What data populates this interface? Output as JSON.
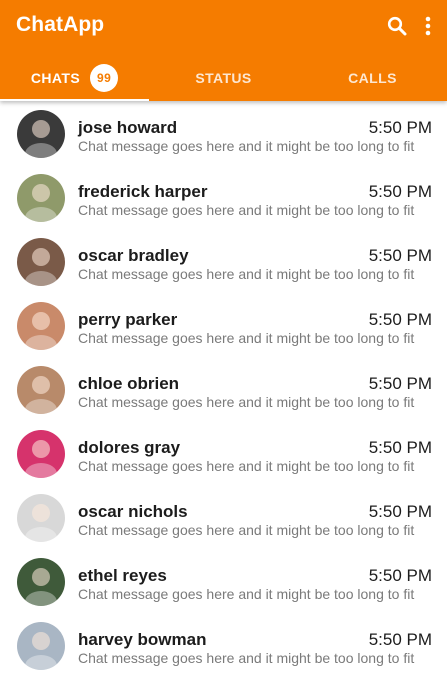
{
  "app": {
    "title": "ChatApp",
    "accent": "#f57c00"
  },
  "actions": {
    "search_icon": "search-icon",
    "more_icon": "more-vert-icon"
  },
  "tabs": [
    {
      "label": "CHATS",
      "badge": "99",
      "active": true
    },
    {
      "label": "STATUS",
      "active": false
    },
    {
      "label": "CALLS",
      "active": false
    }
  ],
  "chats": [
    {
      "name": "jose howard",
      "time": "5:50 PM",
      "message": "Chat message goes here and it might be too long to fit",
      "avatar_color": "#3a3a3a"
    },
    {
      "name": "frederick harper",
      "time": "5:50 PM",
      "message": "Chat message goes here and it might be too long to fit",
      "avatar_color": "#8f9a6a"
    },
    {
      "name": "oscar bradley",
      "time": "5:50 PM",
      "message": "Chat message goes here and it might be too long to fit",
      "avatar_color": "#7a5a48"
    },
    {
      "name": "perry parker",
      "time": "5:50 PM",
      "message": "Chat message goes here and it might be too long to fit",
      "avatar_color": "#c98a6a"
    },
    {
      "name": "chloe obrien",
      "time": "5:50 PM",
      "message": "Chat message goes here and it might be too long to fit",
      "avatar_color": "#b88a6a"
    },
    {
      "name": "dolores gray",
      "time": "5:50 PM",
      "message": "Chat message goes here and it might be too long to fit",
      "avatar_color": "#d6336c"
    },
    {
      "name": "oscar nichols",
      "time": "5:50 PM",
      "message": "Chat message goes here and it might be too long to fit",
      "avatar_color": "#d8d8d8"
    },
    {
      "name": "ethel reyes",
      "time": "5:50 PM",
      "message": "Chat message goes here and it might be too long to fit",
      "avatar_color": "#3f5a3a"
    },
    {
      "name": "harvey bowman",
      "time": "5:50 PM",
      "message": "Chat message goes here and it might be too long to fit",
      "avatar_color": "#a9b6c4"
    }
  ]
}
